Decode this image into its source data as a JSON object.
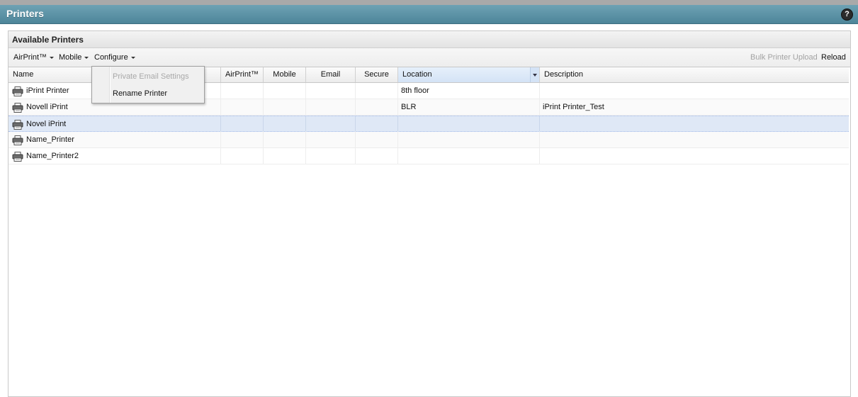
{
  "window": {
    "title": "Printers"
  },
  "panel": {
    "title": "Available Printers"
  },
  "toolbar": {
    "airprint": "AirPrint™",
    "mobile": "Mobile",
    "configure": "Configure",
    "bulk_upload": "Bulk Printer Upload",
    "reload": "Reload"
  },
  "configure_menu": {
    "items": [
      {
        "label": "Private Email Settings",
        "enabled": false
      },
      {
        "label": "Rename Printer",
        "enabled": true
      }
    ]
  },
  "grid": {
    "columns": [
      "Name",
      "",
      "AirPrint™",
      "Mobile",
      "Email",
      "Secure",
      "Location",
      "Description"
    ],
    "sorted_column": "Location",
    "rows": [
      {
        "name": "iPrint Printer",
        "location": "8th floor",
        "description": ""
      },
      {
        "name": "Novell iPrint",
        "location": "BLR",
        "description": "iPrint Printer_Test"
      },
      {
        "name": "Novel iPrint",
        "location": "",
        "description": "",
        "selected": true
      },
      {
        "name": "Name_Printer",
        "location": "",
        "description": ""
      },
      {
        "name": "Name_Printer2",
        "location": "",
        "description": ""
      }
    ]
  },
  "icons": {
    "help": "?",
    "row_icon": "printer-icon"
  },
  "colors": {
    "title_bar": "#5a93a6",
    "selected_row": "#dfe8f6"
  }
}
